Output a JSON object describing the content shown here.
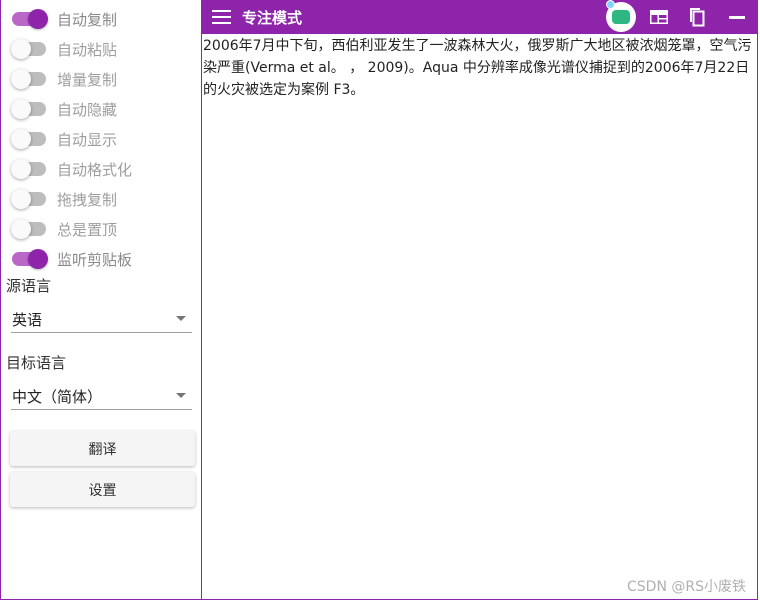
{
  "sidebar": {
    "toggles": [
      {
        "label": "自动复制",
        "on": true
      },
      {
        "label": "自动粘贴",
        "on": false
      },
      {
        "label": "增量复制",
        "on": false
      },
      {
        "label": "自动隐藏",
        "on": false
      },
      {
        "label": "自动显示",
        "on": false
      },
      {
        "label": "自动格式化",
        "on": false
      },
      {
        "label": "拖拽复制",
        "on": false
      },
      {
        "label": "总是置顶",
        "on": false
      },
      {
        "label": "监听剪贴板",
        "on": true
      }
    ],
    "source_language": {
      "label": "源语言",
      "value": "英语"
    },
    "target_language": {
      "label": "目标语言",
      "value": "中文（简体）"
    },
    "translate_button": "翻译",
    "settings_button": "设置"
  },
  "topbar": {
    "title": "专注模式"
  },
  "result": {
    "text": "2006年7月中下旬，西伯利亚发生了一波森林大火，俄罗斯广大地区被浓烟笼罩，空气污染严重(Verma et al。 ， 2009)。Aqua 中分辨率成像光谱仪捕捉到的2006年7月22日的火灾被选定为案例 F3。"
  },
  "watermark": "CSDN @RS小废铁",
  "colors": {
    "accent": "#8e24aa",
    "switch_on_track": "#ba68c8",
    "switch_off_track": "#bdbdbd"
  },
  "icons": {
    "menu": "hamburger-menu-icon",
    "avatar": "app-badge-icon",
    "layout": "layout-grid-icon",
    "copy": "copy-icon",
    "minimize": "minimize-icon"
  }
}
